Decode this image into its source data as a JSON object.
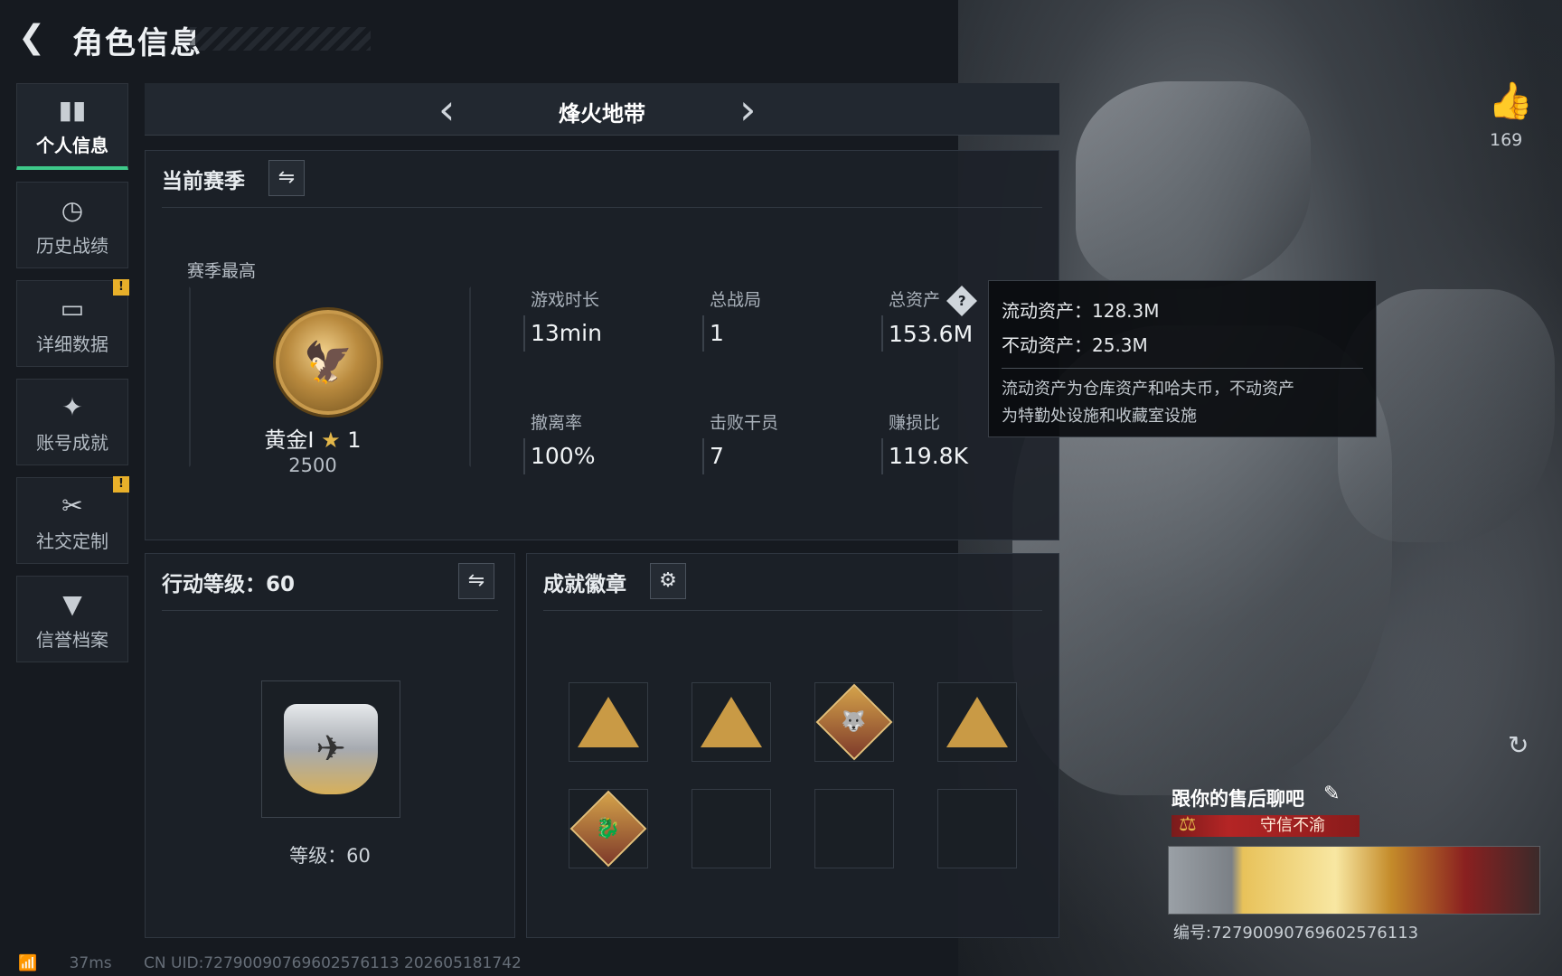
{
  "header": {
    "title": "角色信息"
  },
  "sidebar": {
    "items": [
      {
        "label": "个人信息",
        "icon": "bar-chart-icon",
        "active": true
      },
      {
        "label": "历史战绩",
        "icon": "history-icon"
      },
      {
        "label": "详细数据",
        "icon": "folder-icon",
        "warn": "!"
      },
      {
        "label": "账号成就",
        "icon": "achievement-icon"
      },
      {
        "label": "社交定制",
        "icon": "tools-icon",
        "warn": "!"
      },
      {
        "label": "信誉档案",
        "icon": "shield-icon"
      }
    ]
  },
  "mode": {
    "name": "烽火地带"
  },
  "season": {
    "title": "当前赛季",
    "best_label": "赛季最高",
    "rank_name": "黄金I",
    "rank_star": "★",
    "rank_level": "1",
    "rank_points": "2500",
    "stats": [
      {
        "label": "游戏时长",
        "value": "13min"
      },
      {
        "label": "总战局",
        "value": "1"
      },
      {
        "label": "总资产",
        "value": "153.6M"
      },
      {
        "label": "撤离率",
        "value": "100%"
      },
      {
        "label": "击败干员",
        "value": "7"
      },
      {
        "label": "赚损比",
        "value": "119.8K"
      }
    ]
  },
  "tooltip": {
    "liquid": "流动资产：128.3M",
    "fixed": "不动资产：25.3M",
    "desc1": "流动资产为仓库资产和哈夫币，不动资产",
    "desc2": "为特勤处设施和收藏室设施"
  },
  "action_level": {
    "title": "行动等级：60",
    "level_label": "等级：60"
  },
  "badges": {
    "title": "成就徽章",
    "row1": [
      "A",
      "S",
      "W",
      "B"
    ],
    "row2": [
      "D"
    ]
  },
  "like": {
    "count": "169"
  },
  "card": {
    "name": "跟你的售后聊吧",
    "credit": "守信不渝",
    "id": "编号:72790090769602576113"
  },
  "footer": {
    "ping": "37ms",
    "uid": "CN UID:72790090769602576113 202605181742"
  }
}
